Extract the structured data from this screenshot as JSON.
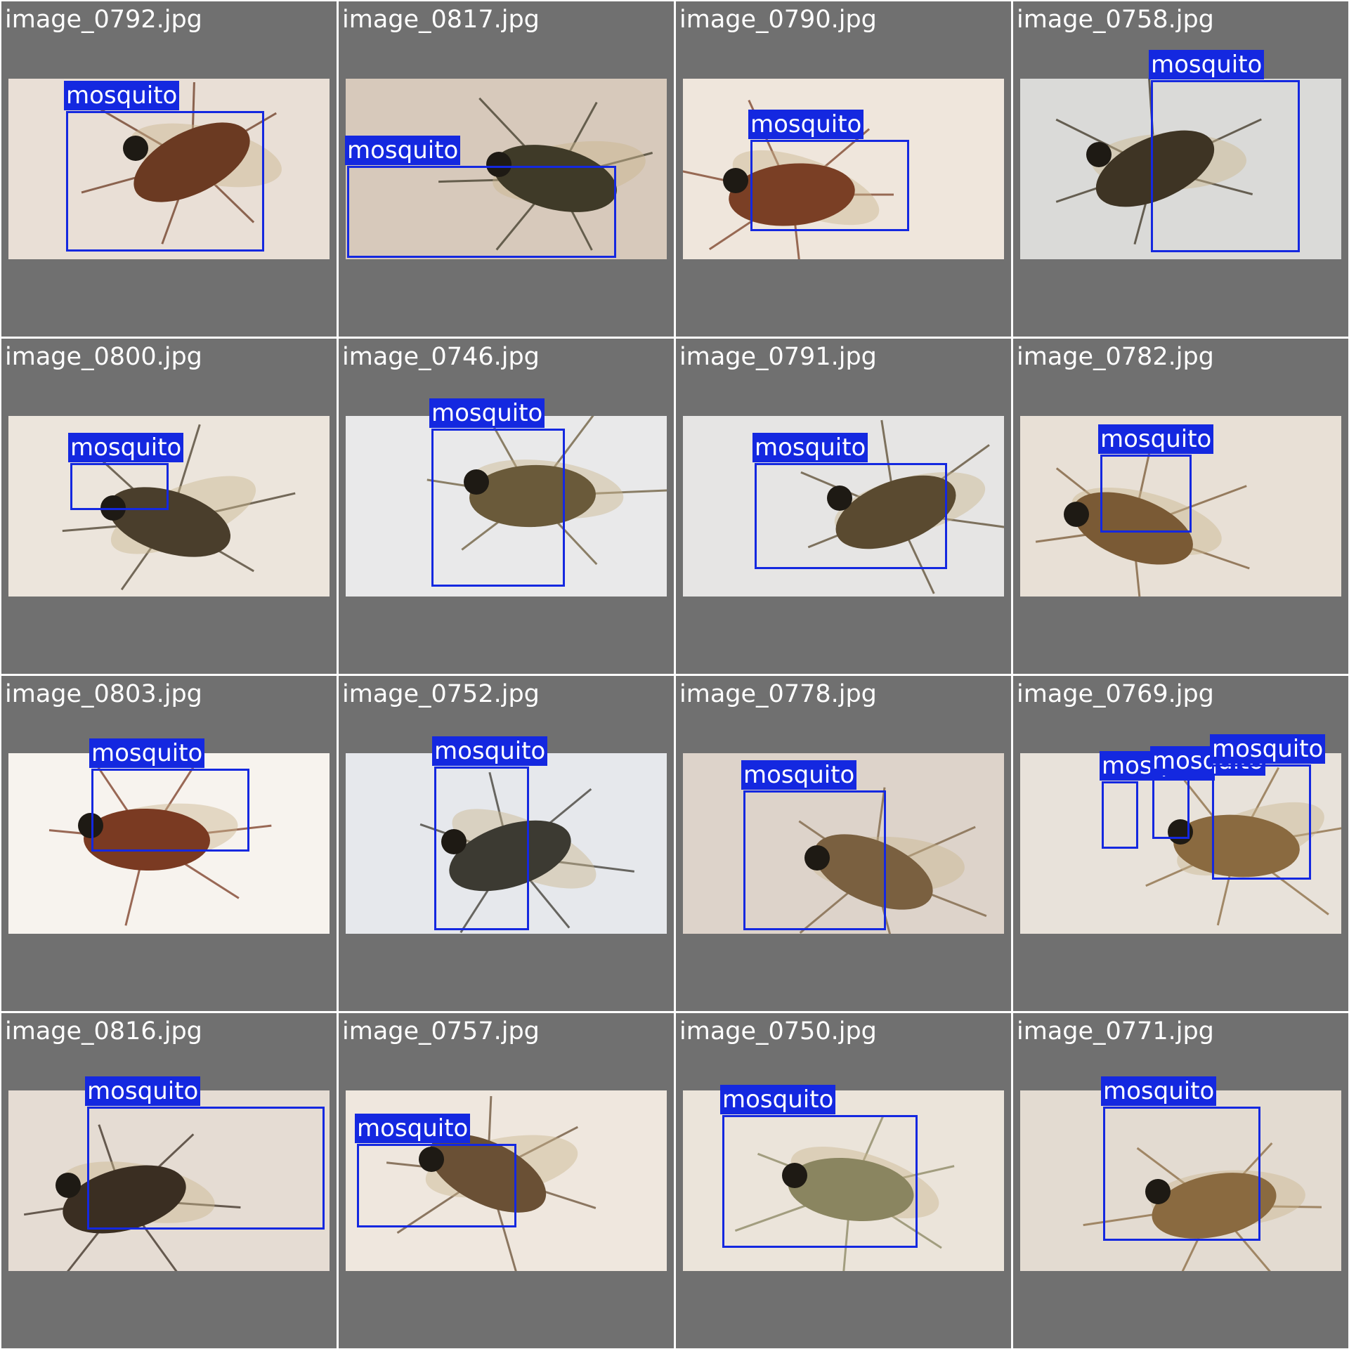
{
  "label_color": "#1428e0",
  "tiles": [
    {
      "filename": "image_0792.jpg",
      "detections": [
        {
          "label": "mosquito"
        }
      ],
      "bg": "#e9dfd6",
      "insect": "#6b3a22"
    },
    {
      "filename": "image_0817.jpg",
      "detections": [
        {
          "label": "mosquito"
        }
      ],
      "bg": "#d7c9bb",
      "insect": "#3f3a28"
    },
    {
      "filename": "image_0790.jpg",
      "detections": [
        {
          "label": "mosquito"
        }
      ],
      "bg": "#efe6dc",
      "insect": "#7a3f25"
    },
    {
      "filename": "image_0758.jpg",
      "detections": [
        {
          "label": "mosquito"
        }
      ],
      "bg": "#dadad8",
      "insect": "#3e3424"
    },
    {
      "filename": "image_0800.jpg",
      "detections": [
        {
          "label": "mosquito"
        }
      ],
      "bg": "#ece5dc",
      "insect": "#4a3e2c"
    },
    {
      "filename": "image_0746.jpg",
      "detections": [
        {
          "label": "mosquito"
        }
      ],
      "bg": "#e9e9ea",
      "insect": "#6a5a3a"
    },
    {
      "filename": "image_0791.jpg",
      "detections": [
        {
          "label": "mosquito"
        }
      ],
      "bg": "#e6e5e4",
      "insect": "#5a4a30"
    },
    {
      "filename": "image_0782.jpg",
      "detections": [
        {
          "label": "mosquito"
        }
      ],
      "bg": "#e8e0d6",
      "insect": "#7a5a35"
    },
    {
      "filename": "image_0803.jpg",
      "detections": [
        {
          "label": "mosquito"
        }
      ],
      "bg": "#f7f3ee",
      "insect": "#7a3a22"
    },
    {
      "filename": "image_0752.jpg",
      "detections": [
        {
          "label": "mosquito"
        }
      ],
      "bg": "#e6e8ec",
      "insect": "#3c3a32"
    },
    {
      "filename": "image_0778.jpg",
      "detections": [
        {
          "label": "mosquito"
        }
      ],
      "bg": "#ddd3ca",
      "insect": "#7a6040"
    },
    {
      "filename": "image_0769.jpg",
      "detections": [
        {
          "label": "mosquito"
        },
        {
          "label": "mosquito"
        },
        {
          "label": "mosquito"
        }
      ],
      "bg": "#e8e2da",
      "insect": "#8a6a40"
    },
    {
      "filename": "image_0816.jpg",
      "detections": [
        {
          "label": "mosquito"
        }
      ],
      "bg": "#e5dcd3",
      "insect": "#3a2e22"
    },
    {
      "filename": "image_0757.jpg",
      "detections": [
        {
          "label": "mosquito"
        }
      ],
      "bg": "#efe7de",
      "insect": "#6a5035"
    },
    {
      "filename": "image_0750.jpg",
      "detections": [
        {
          "label": "mosquito"
        }
      ],
      "bg": "#ebe4da",
      "insect": "#8a8560"
    },
    {
      "filename": "image_0771.jpg",
      "detections": [
        {
          "label": "mosquito"
        }
      ],
      "bg": "#e3dbd1",
      "insect": "#8a6a40"
    }
  ]
}
